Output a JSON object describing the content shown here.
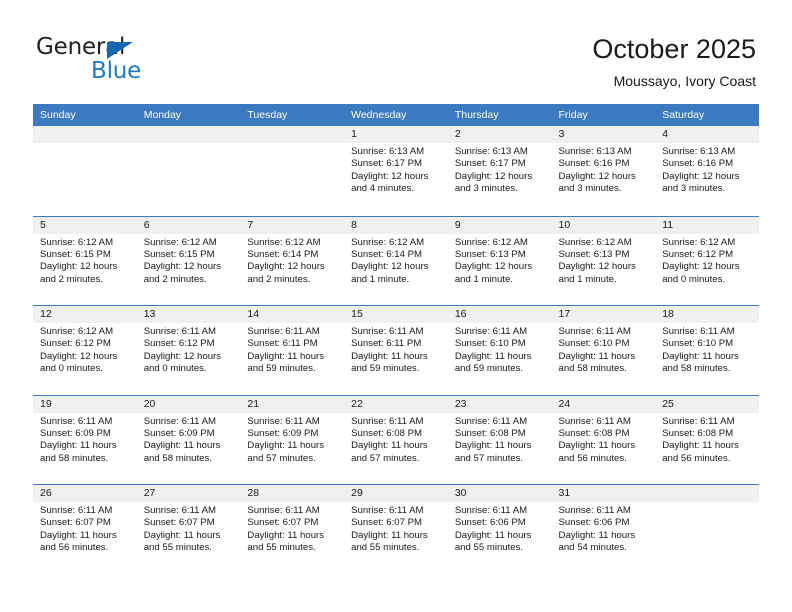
{
  "logo": {
    "word_one": "General",
    "word_two": "Blue",
    "triangle_color": "#1567b2",
    "blue_color": "#1f7ac4"
  },
  "header": {
    "title": "October 2025",
    "subtitle": "Moussayo, Ivory Coast"
  },
  "colors": {
    "header_band": "#3b7ac0",
    "day_number_band": "#f0f0f0",
    "cell_background": "#ffffff",
    "text": "#1a1a1a"
  },
  "weekdays": [
    "Sunday",
    "Monday",
    "Tuesday",
    "Wednesday",
    "Thursday",
    "Friday",
    "Saturday"
  ],
  "weeks": [
    [
      {
        "day": "",
        "sunrise": "",
        "sunset": "",
        "daylight_line1": "",
        "daylight_line2": "",
        "empty": true
      },
      {
        "day": "",
        "sunrise": "",
        "sunset": "",
        "daylight_line1": "",
        "daylight_line2": "",
        "empty": true
      },
      {
        "day": "",
        "sunrise": "",
        "sunset": "",
        "daylight_line1": "",
        "daylight_line2": "",
        "empty": true
      },
      {
        "day": "1",
        "sunrise": "Sunrise: 6:13 AM",
        "sunset": "Sunset: 6:17 PM",
        "daylight_line1": "Daylight: 12 hours",
        "daylight_line2": "and 4 minutes."
      },
      {
        "day": "2",
        "sunrise": "Sunrise: 6:13 AM",
        "sunset": "Sunset: 6:17 PM",
        "daylight_line1": "Daylight: 12 hours",
        "daylight_line2": "and 3 minutes."
      },
      {
        "day": "3",
        "sunrise": "Sunrise: 6:13 AM",
        "sunset": "Sunset: 6:16 PM",
        "daylight_line1": "Daylight: 12 hours",
        "daylight_line2": "and 3 minutes."
      },
      {
        "day": "4",
        "sunrise": "Sunrise: 6:13 AM",
        "sunset": "Sunset: 6:16 PM",
        "daylight_line1": "Daylight: 12 hours",
        "daylight_line2": "and 3 minutes."
      }
    ],
    [
      {
        "day": "5",
        "sunrise": "Sunrise: 6:12 AM",
        "sunset": "Sunset: 6:15 PM",
        "daylight_line1": "Daylight: 12 hours",
        "daylight_line2": "and 2 minutes."
      },
      {
        "day": "6",
        "sunrise": "Sunrise: 6:12 AM",
        "sunset": "Sunset: 6:15 PM",
        "daylight_line1": "Daylight: 12 hours",
        "daylight_line2": "and 2 minutes."
      },
      {
        "day": "7",
        "sunrise": "Sunrise: 6:12 AM",
        "sunset": "Sunset: 6:14 PM",
        "daylight_line1": "Daylight: 12 hours",
        "daylight_line2": "and 2 minutes."
      },
      {
        "day": "8",
        "sunrise": "Sunrise: 6:12 AM",
        "sunset": "Sunset: 6:14 PM",
        "daylight_line1": "Daylight: 12 hours",
        "daylight_line2": "and 1 minute."
      },
      {
        "day": "9",
        "sunrise": "Sunrise: 6:12 AM",
        "sunset": "Sunset: 6:13 PM",
        "daylight_line1": "Daylight: 12 hours",
        "daylight_line2": "and 1 minute."
      },
      {
        "day": "10",
        "sunrise": "Sunrise: 6:12 AM",
        "sunset": "Sunset: 6:13 PM",
        "daylight_line1": "Daylight: 12 hours",
        "daylight_line2": "and 1 minute."
      },
      {
        "day": "11",
        "sunrise": "Sunrise: 6:12 AM",
        "sunset": "Sunset: 6:12 PM",
        "daylight_line1": "Daylight: 12 hours",
        "daylight_line2": "and 0 minutes."
      }
    ],
    [
      {
        "day": "12",
        "sunrise": "Sunrise: 6:12 AM",
        "sunset": "Sunset: 6:12 PM",
        "daylight_line1": "Daylight: 12 hours",
        "daylight_line2": "and 0 minutes."
      },
      {
        "day": "13",
        "sunrise": "Sunrise: 6:11 AM",
        "sunset": "Sunset: 6:12 PM",
        "daylight_line1": "Daylight: 12 hours",
        "daylight_line2": "and 0 minutes."
      },
      {
        "day": "14",
        "sunrise": "Sunrise: 6:11 AM",
        "sunset": "Sunset: 6:11 PM",
        "daylight_line1": "Daylight: 11 hours",
        "daylight_line2": "and 59 minutes."
      },
      {
        "day": "15",
        "sunrise": "Sunrise: 6:11 AM",
        "sunset": "Sunset: 6:11 PM",
        "daylight_line1": "Daylight: 11 hours",
        "daylight_line2": "and 59 minutes."
      },
      {
        "day": "16",
        "sunrise": "Sunrise: 6:11 AM",
        "sunset": "Sunset: 6:10 PM",
        "daylight_line1": "Daylight: 11 hours",
        "daylight_line2": "and 59 minutes."
      },
      {
        "day": "17",
        "sunrise": "Sunrise: 6:11 AM",
        "sunset": "Sunset: 6:10 PM",
        "daylight_line1": "Daylight: 11 hours",
        "daylight_line2": "and 58 minutes."
      },
      {
        "day": "18",
        "sunrise": "Sunrise: 6:11 AM",
        "sunset": "Sunset: 6:10 PM",
        "daylight_line1": "Daylight: 11 hours",
        "daylight_line2": "and 58 minutes."
      }
    ],
    [
      {
        "day": "19",
        "sunrise": "Sunrise: 6:11 AM",
        "sunset": "Sunset: 6:09 PM",
        "daylight_line1": "Daylight: 11 hours",
        "daylight_line2": "and 58 minutes."
      },
      {
        "day": "20",
        "sunrise": "Sunrise: 6:11 AM",
        "sunset": "Sunset: 6:09 PM",
        "daylight_line1": "Daylight: 11 hours",
        "daylight_line2": "and 58 minutes."
      },
      {
        "day": "21",
        "sunrise": "Sunrise: 6:11 AM",
        "sunset": "Sunset: 6:09 PM",
        "daylight_line1": "Daylight: 11 hours",
        "daylight_line2": "and 57 minutes."
      },
      {
        "day": "22",
        "sunrise": "Sunrise: 6:11 AM",
        "sunset": "Sunset: 6:08 PM",
        "daylight_line1": "Daylight: 11 hours",
        "daylight_line2": "and 57 minutes."
      },
      {
        "day": "23",
        "sunrise": "Sunrise: 6:11 AM",
        "sunset": "Sunset: 6:08 PM",
        "daylight_line1": "Daylight: 11 hours",
        "daylight_line2": "and 57 minutes."
      },
      {
        "day": "24",
        "sunrise": "Sunrise: 6:11 AM",
        "sunset": "Sunset: 6:08 PM",
        "daylight_line1": "Daylight: 11 hours",
        "daylight_line2": "and 56 minutes."
      },
      {
        "day": "25",
        "sunrise": "Sunrise: 6:11 AM",
        "sunset": "Sunset: 6:08 PM",
        "daylight_line1": "Daylight: 11 hours",
        "daylight_line2": "and 56 minutes."
      }
    ],
    [
      {
        "day": "26",
        "sunrise": "Sunrise: 6:11 AM",
        "sunset": "Sunset: 6:07 PM",
        "daylight_line1": "Daylight: 11 hours",
        "daylight_line2": "and 56 minutes."
      },
      {
        "day": "27",
        "sunrise": "Sunrise: 6:11 AM",
        "sunset": "Sunset: 6:07 PM",
        "daylight_line1": "Daylight: 11 hours",
        "daylight_line2": "and 55 minutes."
      },
      {
        "day": "28",
        "sunrise": "Sunrise: 6:11 AM",
        "sunset": "Sunset: 6:07 PM",
        "daylight_line1": "Daylight: 11 hours",
        "daylight_line2": "and 55 minutes."
      },
      {
        "day": "29",
        "sunrise": "Sunrise: 6:11 AM",
        "sunset": "Sunset: 6:07 PM",
        "daylight_line1": "Daylight: 11 hours",
        "daylight_line2": "and 55 minutes."
      },
      {
        "day": "30",
        "sunrise": "Sunrise: 6:11 AM",
        "sunset": "Sunset: 6:06 PM",
        "daylight_line1": "Daylight: 11 hours",
        "daylight_line2": "and 55 minutes."
      },
      {
        "day": "31",
        "sunrise": "Sunrise: 6:11 AM",
        "sunset": "Sunset: 6:06 PM",
        "daylight_line1": "Daylight: 11 hours",
        "daylight_line2": "and 54 minutes."
      },
      {
        "day": "",
        "sunrise": "",
        "sunset": "",
        "daylight_line1": "",
        "daylight_line2": "",
        "empty": true
      }
    ]
  ]
}
